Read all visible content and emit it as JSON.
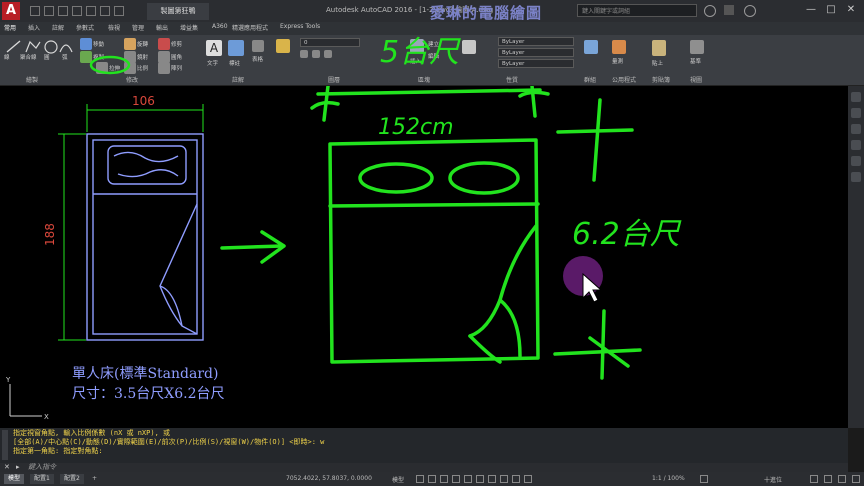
{
  "titlebar": {
    "logo": "A",
    "file_tab": "製圖第狂鴨",
    "title": "Autodesk AutoCAD 2016 - [1-2.dwg] 繪圖-A.dwg",
    "watermark": "愛琳的電腦繪圖",
    "search_placeholder": "鍵入關鍵字或詞組",
    "controls": [
      "—",
      "□",
      "✕"
    ]
  },
  "ribbon_tabs": [
    "常用",
    "插入",
    "註解",
    "參數式",
    "檢視",
    "管理",
    "輸出",
    "增益集",
    "A360",
    "精選應用程式",
    "Express Tools"
  ],
  "ribbon": {
    "panels": [
      "繪製",
      "修改",
      "註解",
      "圖層",
      "區塊",
      "性質",
      "群組",
      "公用程式",
      "剪貼簿",
      "視圖"
    ],
    "modify_tools": [
      "移動",
      "旋轉",
      "修剪",
      "複製",
      "鏡射",
      "圓角",
      "拉伸",
      "比例",
      "陣列"
    ],
    "draw_tools": [
      "線",
      "聚合線",
      "圓",
      "弧"
    ],
    "annotation_tools": [
      "文字",
      "標註",
      "表格"
    ],
    "layer_value": "0",
    "prop_bylayer_1": "ByLayer",
    "prop_bylayer_2": "ByLayer",
    "prop_bylayer_3": "ByLayer",
    "block_tools": [
      "插入",
      "建立",
      "編輯"
    ],
    "utility_tools": [
      "量測"
    ],
    "clipboard_tools": [
      "貼上"
    ],
    "view_tools": [
      "基準"
    ]
  },
  "drawing": {
    "dim_width": "106",
    "dim_height": "188",
    "caption_line1": "單人床(標準Standard)",
    "caption_line2": "尺寸：3.5台尺X6.2台尺",
    "hand_top": "5台尺",
    "hand_width": "152cm",
    "hand_side": "6.2台尺",
    "accent_green": "#22e31e",
    "accent_blue": "#8f9dff",
    "accent_red": "#d8473b"
  },
  "command": {
    "history": [
      "指定視窗角點, 輸入比例係數 (nX 或 nXP), 或",
      "[全部(A)/中心點(C)/動態(D)/實際範圍(E)/前次(P)/比例(S)/視窗(W)/物件(O)] <即時>: w",
      "指定第一角點: 指定對角點:"
    ],
    "prompt": "鍵入指令"
  },
  "status": {
    "layouts": [
      "模型",
      "配置1",
      "配置2"
    ],
    "coordinates": "7052.4022, 57.8037, 0.0000",
    "mode": "模型",
    "scale": "1:1 / 100%",
    "decimal": "十進位"
  }
}
